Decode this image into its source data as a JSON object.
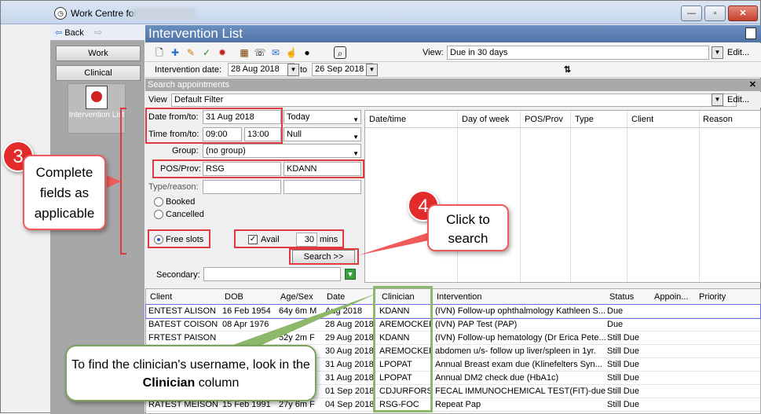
{
  "window": {
    "title": "Work Centre for"
  },
  "left": {
    "back": "Back",
    "work": "Work",
    "clinical": "Clinical",
    "tile_label": "Intervention List"
  },
  "main": {
    "title": "Intervention List"
  },
  "view": {
    "label": "View:",
    "value": "Due in 30 days",
    "edit": "Edit..."
  },
  "datebar": {
    "label": "Intervention date:",
    "from": "28 Aug 2018",
    "to_label": "to",
    "to": "26 Sep 2018"
  },
  "search": {
    "header": "Search appointments",
    "view_label": "View",
    "filter": "Default Filter",
    "edit": "Edit...",
    "date_label": "Date from/to:",
    "date_value": "31 Aug 2018",
    "date_preset": "Today",
    "time_label": "Time from/to:",
    "time_from": "09:00",
    "time_to": "13:00",
    "time_preset": "Null",
    "group_label": "Group:",
    "group_value": "(no group)",
    "pos_label": "POS/Prov:",
    "pos_value": "RSG",
    "prov_value": "KDANN",
    "type_label": "Type/reason:",
    "booked": "Booked",
    "cancelled": "Cancelled",
    "free_slots": "Free slots",
    "avail": "Avail",
    "avail_value": "30",
    "mins": "mins",
    "search_btn": "Search >>",
    "secondary": "Secondary:"
  },
  "appt_columns": [
    "Date/time",
    "Day of week",
    "POS/Prov",
    "Type",
    "Client",
    "Reason"
  ],
  "list_columns": [
    "Client",
    "DOB",
    "Age/Sex",
    "Date",
    "Clinician",
    "Intervention",
    "Status",
    "Appoin...",
    "Priority"
  ],
  "rows": [
    {
      "client": "ENTEST ALISON",
      "dob": "16 Feb 1954",
      "age": "64y 6m M",
      "date": "Aug 2018",
      "clin": "KDANN",
      "int": "(IVN) Follow-up ophthalmology Kathleen S...",
      "status": "Due"
    },
    {
      "client": "BATEST COISON",
      "dob": "08 Apr 1976",
      "age": "",
      "date": "28 Aug 2018",
      "clin": "AREMOCKER",
      "int": "(IVN) PAP Test (PAP)",
      "status": "Due"
    },
    {
      "client": "FRTEST PAISON",
      "dob": "",
      "age": "52y 2m F",
      "date": "29 Aug 2018",
      "clin": "KDANN",
      "int": "(IVN) Follow-up hematology (Dr Erica Pete...",
      "status": "Still Due"
    },
    {
      "client": "",
      "dob": "",
      "age": "",
      "date": "30 Aug 2018",
      "clin": "AREMOCKER",
      "int": "abdomen u/s- follow up liver/spleen in 1yr.",
      "status": "Still Due"
    },
    {
      "client": "",
      "dob": "",
      "age": "",
      "date": "31 Aug 2018",
      "clin": "LPOPAT",
      "int": "Annual Breast exam due (Klinefelters Syn...",
      "status": "Still Due"
    },
    {
      "client": "",
      "dob": "",
      "age": "",
      "date": "31 Aug 2018",
      "clin": "LPOPAT",
      "int": "Annual DM2 check due (HbA1c)",
      "status": "Still Due"
    },
    {
      "client": "",
      "dob": "",
      "age": "",
      "date": "01 Sep 2018",
      "clin": "CDJURFORS",
      "int": "FECAL IMMUNOCHEMICAL TEST(FIT)-due ...",
      "status": "Still Due"
    },
    {
      "client": "RATEST MEISON",
      "dob": "15 Feb 1991",
      "age": "27y 6m F",
      "date": "04 Sep 2018",
      "clin": "RSG-FOC",
      "int": "Repeat Pap",
      "status": "Still Due"
    }
  ],
  "annotations": {
    "n3": "3",
    "c3": "Complete fields as applicable",
    "n4": "4",
    "c4": "Click to search",
    "green_pre": "To find the clinician's username, look in the",
    "green_bold": "Clinician",
    "green_post": "column"
  }
}
